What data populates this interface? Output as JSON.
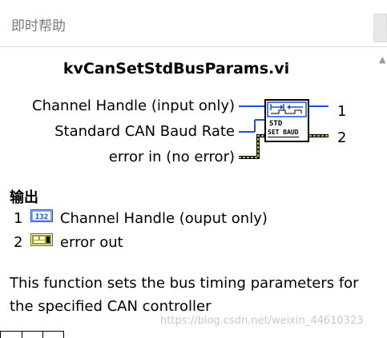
{
  "window": {
    "title": "即时帮助"
  },
  "vi": {
    "name": "kvCanSetStdBusParams.vi",
    "icon_top_text": "STD",
    "icon_bottom_text": "SET BAUD"
  },
  "inputs": [
    {
      "label": "Channel Handle (input only)",
      "wire_color": "#1c4fd6"
    },
    {
      "label": "Standard CAN Baud Rate",
      "wire_color": "#1c4fd6"
    },
    {
      "label": "error in (no error)",
      "wire_color": "#9c9c00"
    }
  ],
  "outputs_terminals": [
    {
      "number": "1",
      "wire_color": "#1c4fd6"
    },
    {
      "number": "2",
      "wire_color": "#9c9c00"
    }
  ],
  "outputs_section": {
    "title": "输出",
    "items": [
      {
        "number": "1",
        "type_icon": "i32-icon",
        "label": "Channel Handle (ouput only)"
      },
      {
        "number": "2",
        "type_icon": "error-cluster-icon",
        "label": "error out"
      }
    ]
  },
  "description": "This function sets the bus timing parameters for the specified CAN controller",
  "watermark": "https://blog.csdn.net/weixin_44610323"
}
